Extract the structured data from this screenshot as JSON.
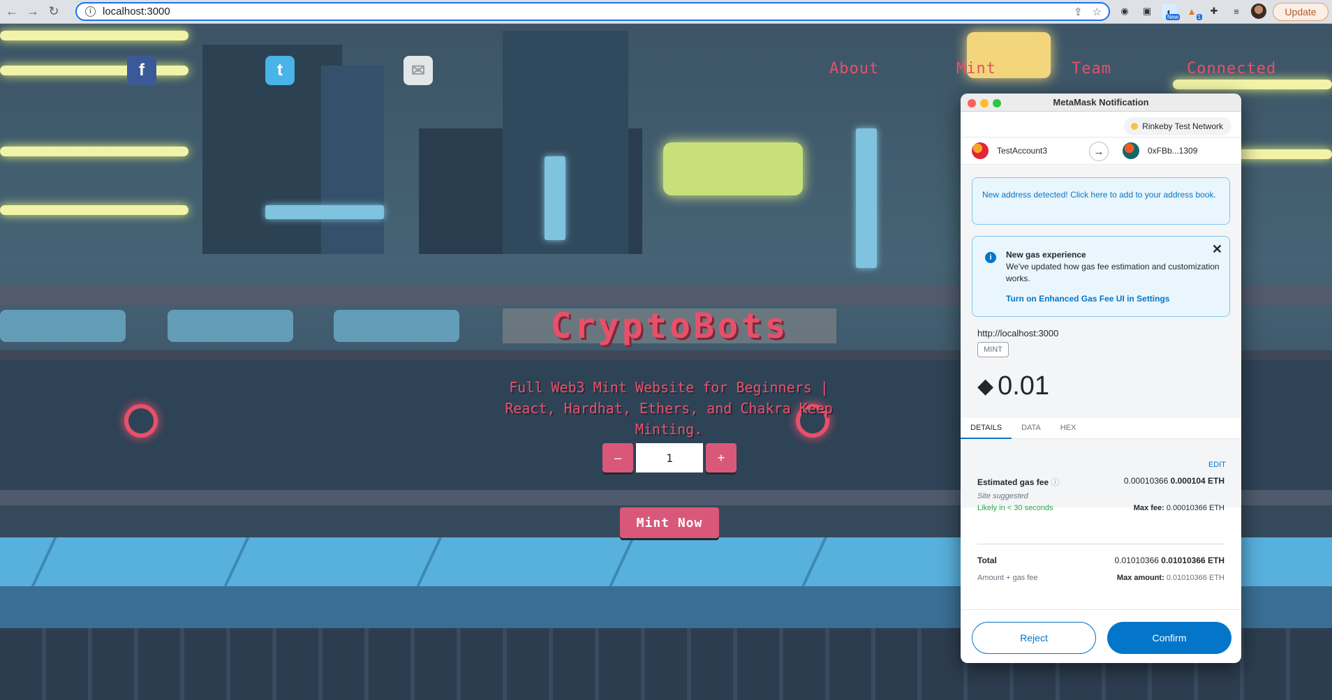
{
  "browser": {
    "url": "localhost:3000",
    "update_label": "Update",
    "ext_badge_new": "New",
    "ext_badge_count": "1"
  },
  "site": {
    "nav": [
      "About",
      "Mint",
      "Team",
      "Connected"
    ],
    "title": "CryptoBots",
    "subtitle": "Full Web3 Mint Website for Beginners | React, Hardhat, Ethers, and Chakra Keep Minting.",
    "minus": "–",
    "plus": "+",
    "quantity": "1",
    "mint_button": "Mint Now"
  },
  "metamask": {
    "window_title": "MetaMask Notification",
    "network": "Rinkeby Test Network",
    "from_account": "TestAccount3",
    "to_account": "0xFBb...1309",
    "address_banner": "New address detected! Click here to add to your address book.",
    "gas_banner_title": "New gas experience",
    "gas_banner_body": "We've updated how gas fee estimation and customization works.",
    "gas_banner_link": "Turn on Enhanced Gas Fee UI in Settings",
    "origin": "http://localhost:3000",
    "method_tag": "MINT",
    "amount": "0.01",
    "tabs": [
      "DETAILS",
      "DATA",
      "HEX"
    ],
    "edit_label": "EDIT",
    "gas_label": "Estimated gas fee",
    "gas_value": "0.00010366",
    "gas_value_bold": "0.000104 ETH",
    "site_suggested": "Site suggested",
    "likely": "Likely in < 30 seconds",
    "max_fee_label": "Max fee:",
    "max_fee_value": "0.00010366 ETH",
    "total_label": "Total",
    "total_value": "0.01010366",
    "total_value_bold": "0.01010366 ETH",
    "amount_gas_label": "Amount + gas fee",
    "max_amount_label": "Max amount:",
    "max_amount_value": "0.01010366 ETH",
    "reject_label": "Reject",
    "confirm_label": "Confirm"
  },
  "colors": {
    "accent_pink": "#e8506a",
    "metamask_blue": "#0376c9",
    "likely_green": "#28a745"
  }
}
